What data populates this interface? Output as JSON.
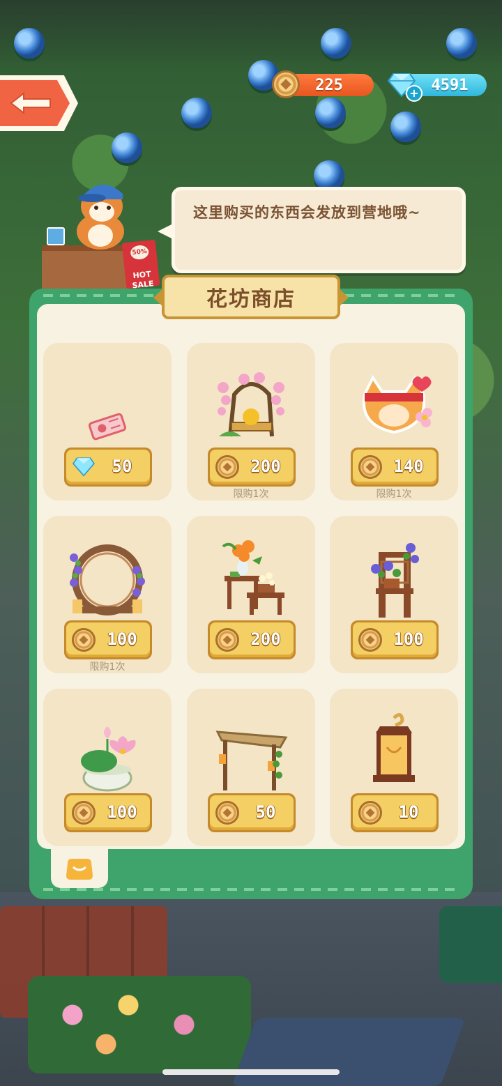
{
  "header": {
    "coins": "225",
    "gems": "4591"
  },
  "npc": {
    "speech": "这里购买的东西会发放到营地哦~",
    "sale_tag": {
      "percent": "50% OFF",
      "hot": "HOT",
      "sale": "SALE"
    }
  },
  "shop": {
    "title": "花坊商店",
    "items": [
      {
        "id": "ticket",
        "currency": "gem",
        "price": "50",
        "limit": ""
      },
      {
        "id": "wisteria-bench",
        "currency": "coin",
        "price": "200",
        "limit": "限购1次"
      },
      {
        "id": "fox-sticker",
        "currency": "coin",
        "price": "140",
        "limit": "限购1次"
      },
      {
        "id": "flower-arch",
        "currency": "coin",
        "price": "100",
        "limit": "限购1次"
      },
      {
        "id": "flower-table",
        "currency": "coin",
        "price": "200",
        "limit": ""
      },
      {
        "id": "plant-stand",
        "currency": "coin",
        "price": "100",
        "limit": ""
      },
      {
        "id": "lotus-pot",
        "currency": "coin",
        "price": "100",
        "limit": ""
      },
      {
        "id": "wood-gate",
        "currency": "coin",
        "price": "50",
        "limit": ""
      },
      {
        "id": "lantern",
        "currency": "coin",
        "price": "10",
        "limit": ""
      }
    ]
  },
  "colors": {
    "panel_green": "#3fa46c",
    "panel_cream": "#f8f2e3",
    "card": "#f3e5c5",
    "price_button": "#f4cf63",
    "coin_bar": "#e7561f",
    "gem_bar": "#2fb7dd",
    "back_button": "#f16443"
  }
}
